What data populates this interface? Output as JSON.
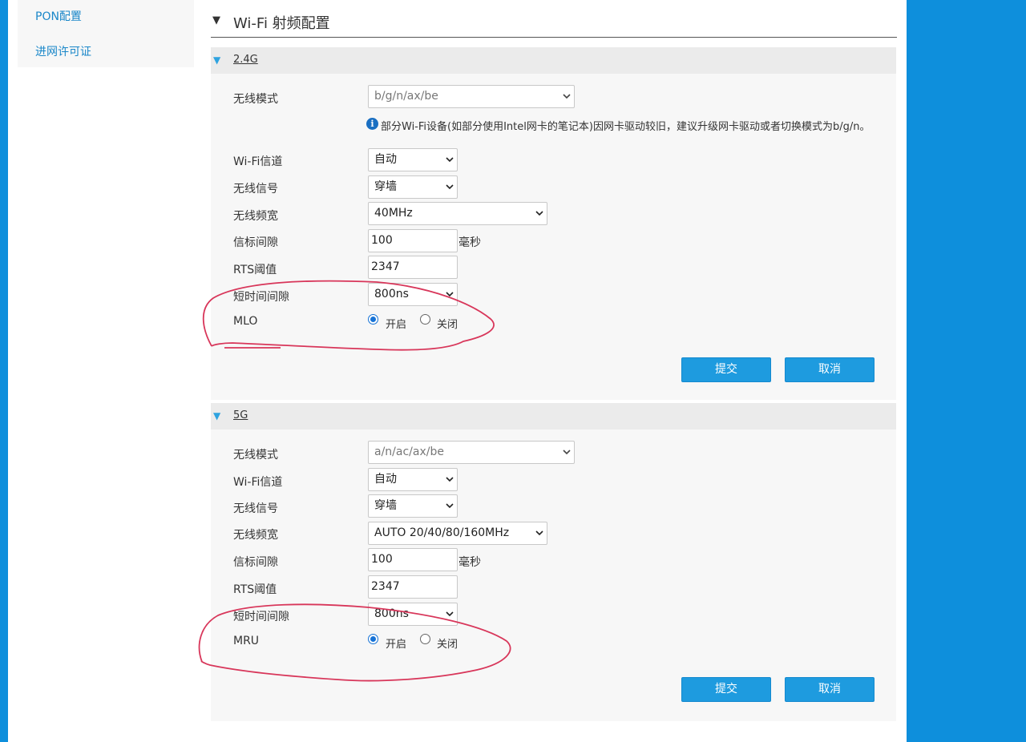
{
  "colors": {
    "accent_blue": "#0e8fdc",
    "button_blue": "#1e9bdf",
    "annotation_red": "#d8365a"
  },
  "sidebar": {
    "items": [
      {
        "label": "PON配置"
      },
      {
        "label": "进网许可证"
      }
    ]
  },
  "page": {
    "title": "Wi-Fi 射频配置",
    "collapse_icon": "triangle-down-icon"
  },
  "sections": [
    {
      "name": "2.4G",
      "wireless_mode": {
        "label": "无线模式",
        "value": "b/g/n/ax/be"
      },
      "notice": {
        "icon": "info-icon",
        "text": "部分Wi-Fi设备(如部分使用Intel网卡的笔记本)因网卡驱动较旧，建议升级网卡驱动或者切换模式为b/g/n。"
      },
      "channel": {
        "label": "Wi-Fi信道",
        "value": "自动"
      },
      "signal": {
        "label": "无线信号",
        "value": "穿墙"
      },
      "bandwidth": {
        "label": "无线频宽",
        "value": "40MHz"
      },
      "beacon": {
        "label": "信标间隙",
        "value": "100",
        "unit": "毫秒"
      },
      "rts": {
        "label": "RTS阈值",
        "value": "2347"
      },
      "guard": {
        "label": "短时间间隙",
        "value": "800ns"
      },
      "toggle": {
        "label": "MLO",
        "on_label": "开启",
        "off_label": "关闭",
        "selected": "on"
      },
      "submit_label": "提交",
      "cancel_label": "取消"
    },
    {
      "name": "5G",
      "wireless_mode": {
        "label": "无线模式",
        "value": "a/n/ac/ax/be"
      },
      "channel": {
        "label": "Wi-Fi信道",
        "value": "自动"
      },
      "signal": {
        "label": "无线信号",
        "value": "穿墙"
      },
      "bandwidth": {
        "label": "无线频宽",
        "value": "AUTO 20/40/80/160MHz"
      },
      "beacon": {
        "label": "信标间隙",
        "value": "100",
        "unit": "毫秒"
      },
      "rts": {
        "label": "RTS阈值",
        "value": "2347"
      },
      "guard": {
        "label": "短时间间隙",
        "value": "800ns"
      },
      "toggle": {
        "label": "MRU",
        "on_label": "开启",
        "off_label": "关闭",
        "selected": "on"
      },
      "submit_label": "提交",
      "cancel_label": "取消"
    }
  ]
}
